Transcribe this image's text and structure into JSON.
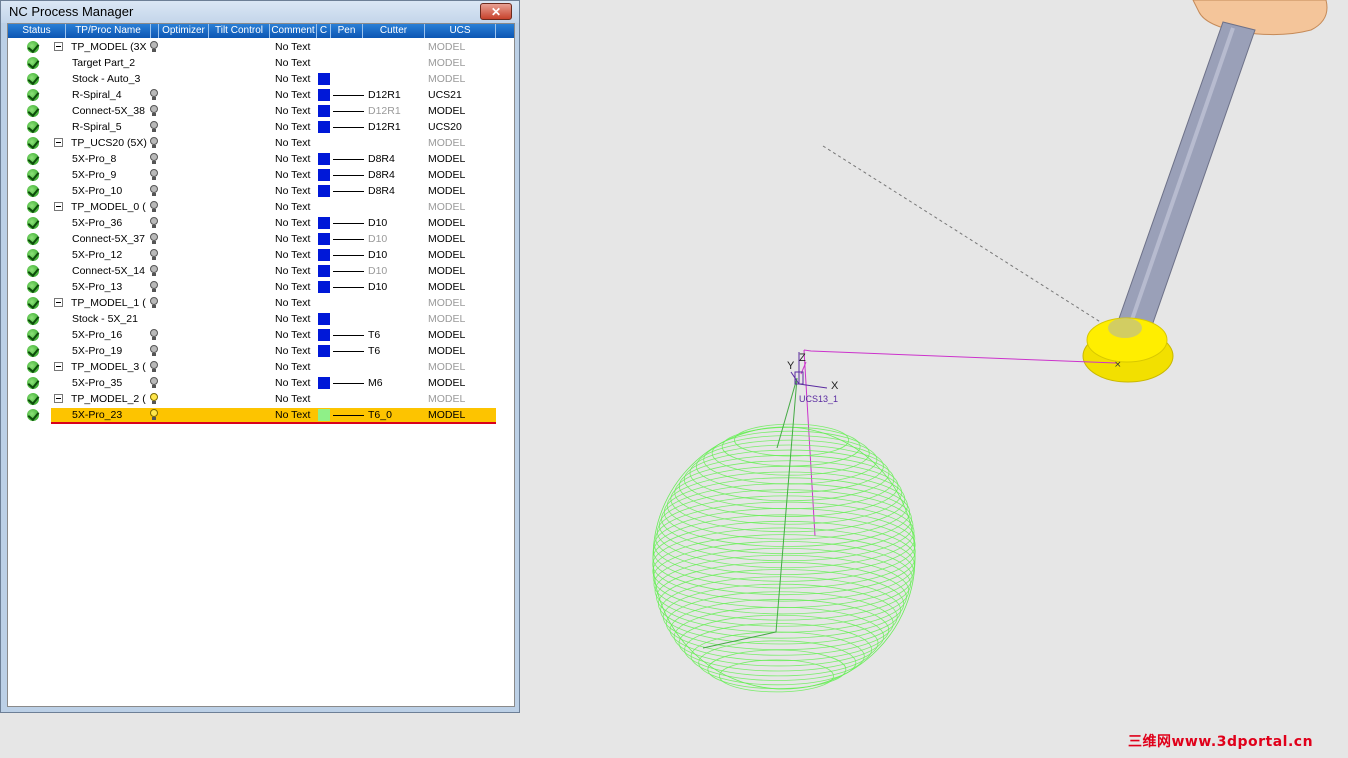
{
  "window": {
    "title": "NC Process Manager",
    "close_label": "✕"
  },
  "columns": [
    {
      "label": "Status"
    },
    {
      "label": "TP/Proc Name"
    },
    {
      "label": "Optimizer"
    },
    {
      "label": "Tilt Control"
    },
    {
      "label": "Comment"
    },
    {
      "label": "C"
    },
    {
      "label": "Pen"
    },
    {
      "label": "Cutter"
    },
    {
      "label": "UCS"
    }
  ],
  "rows": [
    {
      "name": "TP_MODEL (3X",
      "level": 0,
      "group": true,
      "bulb": true,
      "comment": "No Text",
      "color": "",
      "cutter": "",
      "ucs": "MODEL",
      "ucs_dim": true
    },
    {
      "name": "Target Part_2",
      "level": 1,
      "comment": "No Text",
      "color": "",
      "cutter": "",
      "ucs": "MODEL",
      "ucs_dim": true
    },
    {
      "name": "Stock - Auto_3",
      "level": 1,
      "comment": "No Text",
      "color": "blue",
      "cutter": "",
      "ucs": "MODEL",
      "ucs_dim": true
    },
    {
      "name": "R-Spiral_4",
      "level": 1,
      "bulb": true,
      "comment": "No Text",
      "color": "blue",
      "pen": true,
      "cutter": "D12R1",
      "ucs": "UCS21"
    },
    {
      "name": "Connect-5X_38",
      "level": 1,
      "bulb": true,
      "comment": "No Text",
      "color": "blue",
      "pen": true,
      "cutter": "D12R1",
      "cutter_dim": true,
      "ucs": "MODEL"
    },
    {
      "name": "R-Spiral_5",
      "level": 1,
      "bulb": true,
      "comment": "No Text",
      "color": "blue",
      "pen": true,
      "cutter": "D12R1",
      "ucs": "UCS20"
    },
    {
      "name": "TP_UCS20 (5X)",
      "level": 0,
      "group": true,
      "bulb": true,
      "comment": "No Text",
      "cutter": "",
      "ucs": "MODEL",
      "ucs_dim": true
    },
    {
      "name": "5X-Pro_8",
      "level": 1,
      "bulb": true,
      "comment": "No Text",
      "color": "blue",
      "pen": true,
      "cutter": "D8R4",
      "ucs": "MODEL"
    },
    {
      "name": "5X-Pro_9",
      "level": 1,
      "bulb": true,
      "comment": "No Text",
      "color": "blue",
      "pen": true,
      "cutter": "D8R4",
      "ucs": "MODEL"
    },
    {
      "name": "5X-Pro_10",
      "level": 1,
      "bulb": true,
      "comment": "No Text",
      "color": "blue",
      "pen": true,
      "cutter": "D8R4",
      "ucs": "MODEL"
    },
    {
      "name": "TP_MODEL_0 (",
      "level": 0,
      "group": true,
      "bulb": true,
      "comment": "No Text",
      "cutter": "",
      "ucs": "MODEL",
      "ucs_dim": true
    },
    {
      "name": "5X-Pro_36",
      "level": 1,
      "bulb": true,
      "comment": "No Text",
      "color": "blue",
      "pen": true,
      "cutter": "D10",
      "ucs": "MODEL"
    },
    {
      "name": "Connect-5X_37",
      "level": 1,
      "bulb": true,
      "comment": "No Text",
      "color": "blue",
      "pen": true,
      "cutter": "D10",
      "cutter_dim": true,
      "ucs": "MODEL"
    },
    {
      "name": "5X-Pro_12",
      "level": 1,
      "bulb": true,
      "comment": "No Text",
      "color": "blue",
      "pen": true,
      "cutter": "D10",
      "ucs": "MODEL"
    },
    {
      "name": "Connect-5X_14",
      "level": 1,
      "bulb": true,
      "comment": "No Text",
      "color": "blue",
      "pen": true,
      "cutter": "D10",
      "cutter_dim": true,
      "ucs": "MODEL"
    },
    {
      "name": "5X-Pro_13",
      "level": 1,
      "bulb": true,
      "comment": "No Text",
      "color": "blue",
      "pen": true,
      "cutter": "D10",
      "ucs": "MODEL"
    },
    {
      "name": "TP_MODEL_1 (",
      "level": 0,
      "group": true,
      "bulb": true,
      "comment": "No Text",
      "cutter": "",
      "ucs": "MODEL",
      "ucs_dim": true
    },
    {
      "name": "Stock - 5X_21",
      "level": 1,
      "comment": "No Text",
      "color": "blue",
      "cutter": "",
      "ucs": "MODEL",
      "ucs_dim": true
    },
    {
      "name": "5X-Pro_16",
      "level": 1,
      "bulb": true,
      "comment": "No Text",
      "color": "blue",
      "pen": true,
      "cutter": "T6",
      "ucs": "MODEL"
    },
    {
      "name": "5X-Pro_19",
      "level": 1,
      "bulb": true,
      "comment": "No Text",
      "color": "blue",
      "pen": true,
      "cutter": "T6",
      "ucs": "MODEL"
    },
    {
      "name": "TP_MODEL_3 (",
      "level": 0,
      "group": true,
      "bulb": true,
      "comment": "No Text",
      "cutter": "",
      "ucs": "MODEL",
      "ucs_dim": true
    },
    {
      "name": "5X-Pro_35",
      "level": 1,
      "bulb": true,
      "comment": "No Text",
      "color": "blue",
      "pen": true,
      "cutter": "M6",
      "ucs": "MODEL"
    },
    {
      "name": "TP_MODEL_2 (",
      "level": 0,
      "group": true,
      "bulb": true,
      "bulb_on": true,
      "comment": "No Text",
      "cutter": "",
      "ucs": "MODEL",
      "ucs_dim": true
    },
    {
      "name": "5X-Pro_23",
      "level": 1,
      "bulb": true,
      "bulb_on": true,
      "selected": true,
      "comment": "No Text",
      "color": "light",
      "pen": true,
      "cutter": "T6_0",
      "ucs": "MODEL"
    }
  ],
  "viewport": {
    "axis_y": "Y",
    "axis_z": "Z",
    "axis_x": "X",
    "ucs_label": "UCS13_1",
    "colors": {
      "sphere": "#66ee55",
      "toolpath": "#cc33cc",
      "holder": "#f4c59a",
      "shank": "#9aa0b8",
      "cutter": "#ffee00"
    }
  },
  "watermark": "三维网www.3dportal.cn"
}
